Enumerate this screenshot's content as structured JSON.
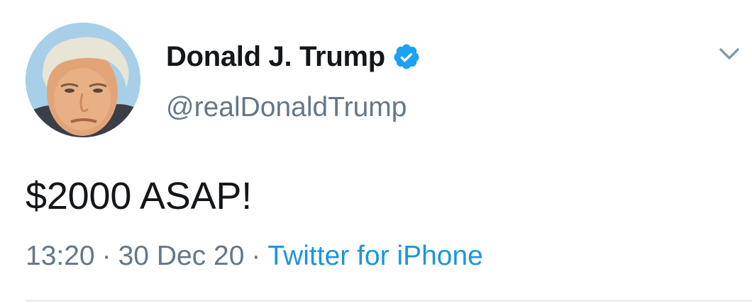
{
  "tweet": {
    "author": {
      "display_name": "Donald J. Trump",
      "handle": "@realDonaldTrump",
      "verified": true,
      "avatar_icon": "profile-photo"
    },
    "text": "$2000 ASAP!",
    "time": "13:20",
    "separator": "·",
    "date": "30 Dec 20",
    "source": "Twitter for iPhone",
    "menu_icon": "chevron-down-icon"
  },
  "colors": {
    "text_primary": "#14171a",
    "text_secondary": "#657786",
    "link_blue": "#1b95e0",
    "verified_blue": "#1da1f2",
    "divider": "#e1e8ed"
  }
}
